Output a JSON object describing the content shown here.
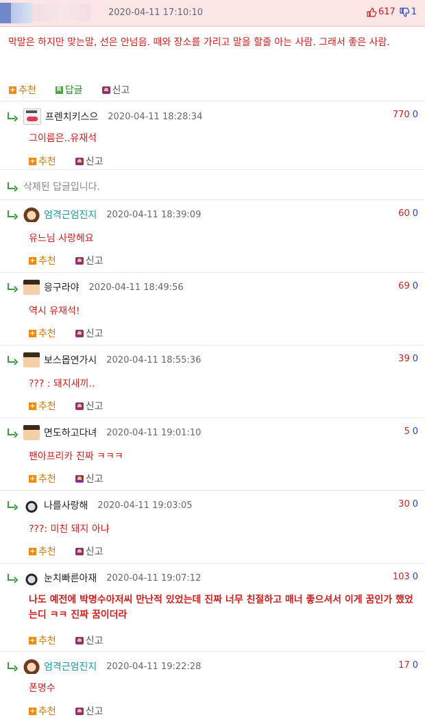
{
  "post": {
    "time": "2020-04-11 17:10:10",
    "up": "617",
    "down": "1",
    "text": "막말은 하지만 맞는말, 선은 안넘음. 때와 장소를 가리고 말을 할줄 아는 사람. 그래서 좋은 사람.",
    "actions": {
      "recommend": "추천",
      "reply": "답글",
      "report": "신고"
    }
  },
  "deleted_text": "삭제된 답글입니다.",
  "replies": [
    {
      "name": "프렌치키스으",
      "time": "2020-04-11 18:28:34",
      "up": "770",
      "down": "0",
      "text": "그이름은..유재석",
      "recommend": "추천",
      "report": "신고"
    },
    {
      "name": "엄격근엄진지",
      "time": "2020-04-11 18:39:09",
      "up": "60",
      "down": "0",
      "text": "유느님 사랑헤요",
      "recommend": "추천",
      "report": "신고"
    },
    {
      "name": "응구라야",
      "time": "2020-04-11 18:49:56",
      "up": "69",
      "down": "0",
      "text": "역시 유재석!",
      "recommend": "추천",
      "report": "신고"
    },
    {
      "name": "보스몹연가시",
      "time": "2020-04-11 18:55:36",
      "up": "39",
      "down": "0",
      "text": "??? : 돼지새끼..",
      "recommend": "추천",
      "report": "신고"
    },
    {
      "name": "면도하고다녀",
      "time": "2020-04-11 19:01:10",
      "up": "5",
      "down": "0",
      "text": "팬아프리카 진짜 ㅋㅋㅋ",
      "recommend": "추천",
      "report": "신고"
    },
    {
      "name": "나를사랑해",
      "time": "2020-04-11 19:03:05",
      "up": "30",
      "down": "0",
      "text": "???: 미친 돼지 아냐",
      "recommend": "추천",
      "report": "신고"
    },
    {
      "name": "눈치빠른아재",
      "time": "2020-04-11 19:07:12",
      "up": "103",
      "down": "0",
      "text": "나도 예전에 박명수아저씨 만난적 있었는데 진짜 너무 친절하고 매너 좋으셔서 이게 꿈인가 했었는디 ㅋㅋ 진짜 꿈이더라",
      "recommend": "추천",
      "report": "신고"
    },
    {
      "name": "엄격근엄진지",
      "time": "2020-04-11 19:22:28",
      "up": "17",
      "down": "0",
      "text": "폰명수",
      "recommend": "추천",
      "report": "신고"
    }
  ]
}
